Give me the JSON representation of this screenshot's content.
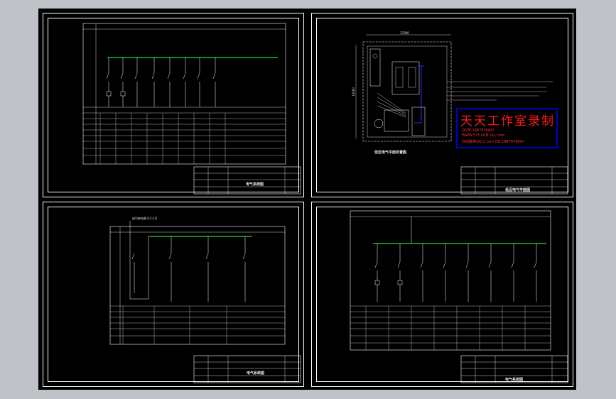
{
  "sheets": {
    "top_left": {
      "title_block_name": "电气系统图"
    },
    "top_right": {
      "plan_title": "低压电气平面布置图",
      "width_dim": "17000",
      "height_dim": "14000",
      "title_block_name": "低压电气平面图"
    },
    "bottom_left": {
      "feeder_note": "由引来电源 (L1-L3)",
      "title_block_name": "电气系统图"
    },
    "bottom_right": {
      "title_block_name": "电气系统图"
    }
  },
  "watermark": {
    "title": "天天工作室录制",
    "line1": "QQ号:1987676847",
    "line2": "WWW.575.OLB.OLL.com",
    "line3": "在线联系QQ:1.com  QQ:1987676847"
  },
  "colors": {
    "background": "#bfc3c8",
    "canvas": "#000000",
    "frame": "#ffffff",
    "busbar": "#22dd22",
    "watermark_red": "#ff1a1a",
    "watermark_border": "#0000cc"
  }
}
